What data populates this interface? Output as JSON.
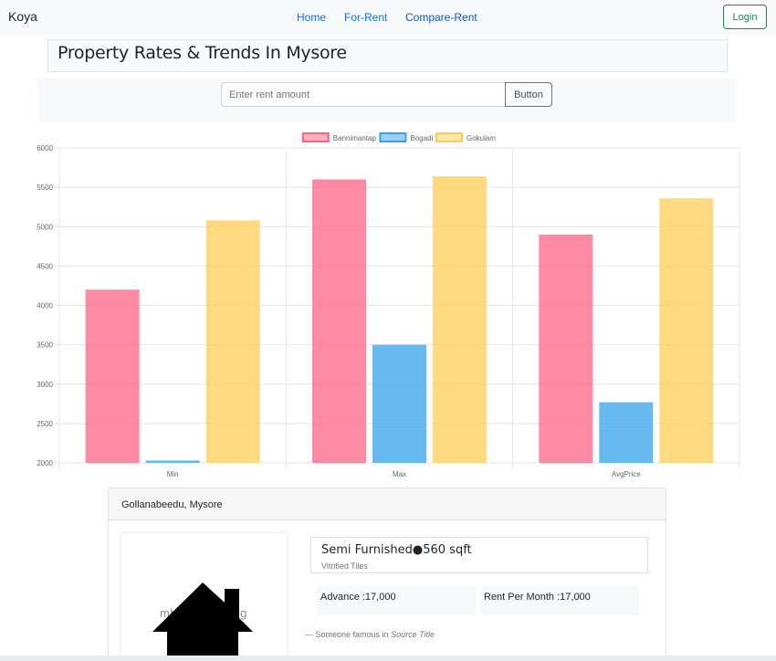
{
  "navbar": {
    "brand": "Koya",
    "links": [
      "Home",
      "For-Rent",
      "Compare-Rent"
    ],
    "login_label": "Login"
  },
  "page": {
    "title": "Property Rates & Trends In Mysore"
  },
  "search": {
    "placeholder": "Enter rent amount",
    "value": "",
    "button_label": "Button"
  },
  "chart_data": {
    "type": "bar",
    "categories": [
      "Min",
      "Max",
      "AvgPrice"
    ],
    "series": [
      {
        "name": "Bannimantap",
        "values": [
          4200,
          5600,
          4900
        ],
        "color": "#ff6384"
      },
      {
        "name": "Bogadi",
        "values": [
          2030,
          3500,
          2770
        ],
        "color": "#36a2eb"
      },
      {
        "name": "Gokulam",
        "values": [
          5080,
          5640,
          5360
        ],
        "color": "#ffcd56"
      }
    ],
    "ylim": [
      2000,
      6000
    ],
    "yticks": [
      2000,
      2500,
      3000,
      3500,
      4000,
      4500,
      5000,
      5500,
      6000
    ],
    "legend": "top-center",
    "grid": true
  },
  "listing": {
    "location": "Gollanabeedu, Mysore",
    "image_alt": "mhtemplate.jpg",
    "spec_title": "Semi Furnished●560 sqft",
    "spec_sub": "Vitrified Tiles",
    "advance": "Advance :17,000",
    "rent_per_month": "Rent Per Month :17,000",
    "quote_prefix": "— Someone famous in ",
    "quote_source": "Source Title"
  },
  "colors": {
    "primary_link": "#0d6efd",
    "success": "#198754",
    "navbar_bg": "#f8f9fa"
  }
}
